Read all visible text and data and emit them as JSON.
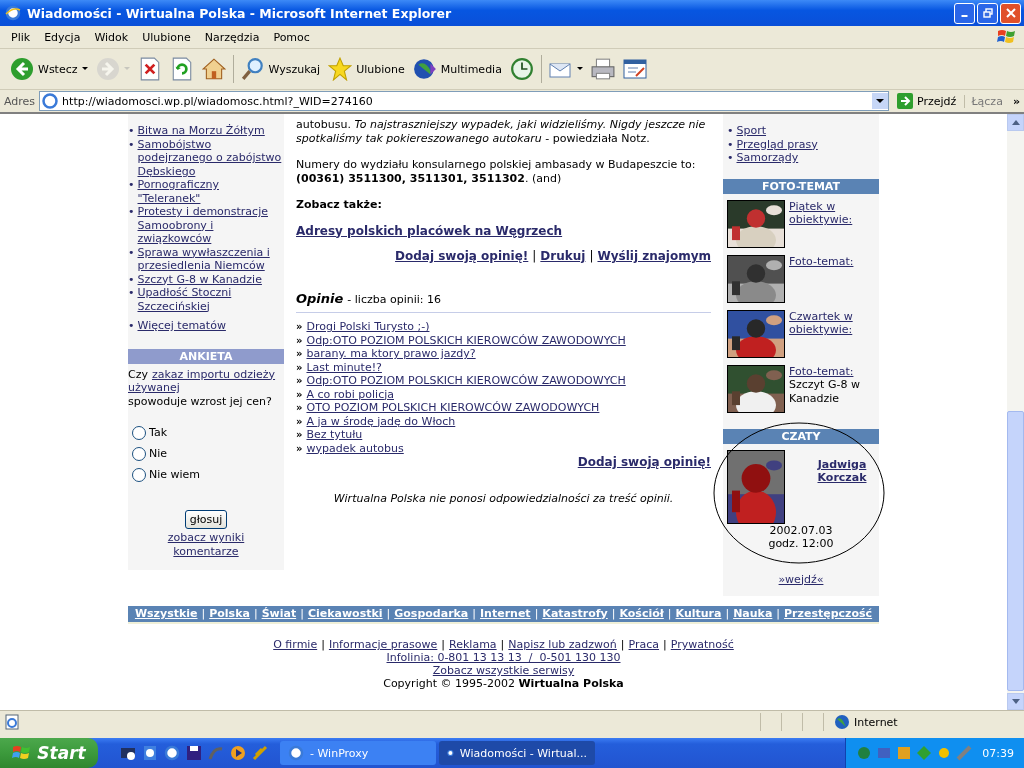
{
  "window": {
    "title": "Wiadomości - Wirtualna Polska - Microsoft Internet Explorer"
  },
  "menu": [
    "Plik",
    "Edycja",
    "Widok",
    "Ulubione",
    "Narzędzia",
    "Pomoc"
  ],
  "toolbar": {
    "groups": [
      [
        {
          "kind": "back",
          "label": "Wstecz",
          "dropdown": true,
          "disabled": false
        },
        {
          "kind": "forward",
          "dropdown": true,
          "disabled": true
        },
        {
          "kind": "stop",
          "dropdown": false,
          "disabled": false
        },
        {
          "kind": "refresh",
          "dropdown": false,
          "disabled": false
        },
        {
          "kind": "home",
          "dropdown": false,
          "disabled": false
        }
      ],
      [
        {
          "kind": "search",
          "label": "Wyszukaj",
          "dropdown": false,
          "disabled": false
        },
        {
          "kind": "favorites",
          "label": "Ulubione",
          "dropdown": false,
          "disabled": false
        },
        {
          "kind": "media",
          "label": "Multimedia",
          "dropdown": false,
          "disabled": false
        },
        {
          "kind": "history",
          "dropdown": false,
          "disabled": false
        }
      ],
      [
        {
          "kind": "mail",
          "dropdown": true,
          "disabled": false
        },
        {
          "kind": "print",
          "dropdown": false,
          "disabled": false
        },
        {
          "kind": "edit",
          "dropdown": false,
          "disabled": false
        }
      ]
    ]
  },
  "address": {
    "label": "Adres",
    "value": "http://wiadomosci.wp.pl/wiadomosc.html?_WID=274160",
    "go": "Przejdź",
    "links": "Łącza",
    "chevron": "»"
  },
  "left": {
    "bullet": "•",
    "topics": [
      "Bitwa na Morzu Żółtym",
      "Samobójstwo podejrzanego o zabójstwo Dębskiego",
      "Pornograficzny \"Teleranek\"",
      "Protesty i demonstracje Samoobrony i związkowców",
      "Sprawa wywłaszczenia i przesiedlenia Niemców",
      "Szczyt G-8 w Kanadzie",
      "Upadłość Stoczni Szczecińskiej"
    ],
    "more": "Więcej tematów",
    "poll": {
      "title": "ANKIETA",
      "question_pre": "Czy",
      "question_link": [
        "zakaz importu odzieży",
        "używanej"
      ],
      "question_post": "spowoduje wzrost jej cen?",
      "options": [
        {
          "label": "Tak",
          "selected": false
        },
        {
          "label": "Nie",
          "selected": false
        },
        {
          "label": "Nie wiem",
          "selected": false
        }
      ],
      "vote": "głosuj",
      "results": "zobacz wyniki komentarze"
    }
  },
  "article": {
    "paragraphs": [
      "autobusu. *To najstraszniejszy wypadek, jaki widzieliśmy. Nigdy jeszcze nie spotkaliśmy tak pokiereszowanego autokaru* - powiedziała Notz.",
      "Numery do wydziału konsularnego polskiej ambasady w Budapeszcie to: **(00361) 3511300, 3511301, 3511302**. (and)"
    ],
    "see_also_title": "Zobacz także:",
    "see_also_links": [
      "Adresy polskich placówek na Węgrzech"
    ],
    "actions": [
      "Dodaj swoją opinię!",
      "Drukuj",
      "Wyślij znajomym"
    ],
    "separator": "|"
  },
  "opinions": {
    "title": "Opinie",
    "count": "- liczba opinii: 16",
    "marker": "»",
    "items": [
      "Drogi Polski Turysto ;-)",
      "Odp:OTO POZIOM POLSKICH KIEROWCÓW ZAWODOWYCH",
      "barany. ma ktory prawo jazdy?",
      "Last minute!?",
      "Odp:OTO POZIOM POLSKICH KIEROWCÓW ZAWODOWYCH",
      "A co robi policja",
      "OTO POZIOM POLSKICH KIEROWCÓW ZAWODOWYCH",
      "A ja w środę jadę do Włoch",
      "Bez tytułu",
      "wypadek autobus"
    ],
    "add": "Dodaj swoją opinię!",
    "disclaimer": "Wirtualna Polska nie ponosi odpowiedzialności za treść opinii."
  },
  "right": {
    "bullet": "•",
    "sections": [
      "Sport",
      "Przegląd prasy",
      "Samorządy"
    ],
    "photo_title": "FOTO-TEMAT",
    "photos": [
      {
        "link": "Piątek w obiektywie:"
      },
      {
        "link": "Foto-temat:"
      },
      {
        "link": "Czwartek w obiektywie:"
      },
      {
        "link": "Foto-temat:",
        "caption": "Szczyt G-8 w Kanadzie"
      }
    ],
    "chat_title": "CZATY",
    "chat": {
      "name": "Jadwiga Korczak",
      "date": "2002.07.03",
      "time": "godz. 12:00"
    },
    "enter": "»wejdź«"
  },
  "footer": {
    "separator": "|",
    "categories": [
      "Wszystkie",
      "Polska",
      "Świat",
      "Ciekawostki",
      "Gospodarka",
      "Internet",
      "Katastrofy",
      "Kościół",
      "Kultura",
      "Nauka",
      "Przestępczość"
    ],
    "links": [
      "O firmie",
      "Informacje prasowe",
      "Reklama",
      "Napisz lub zadzwoń",
      "Praca",
      "Prywatność"
    ],
    "hotline": "Infolinia: 0-801 13 13 13  /  0-501 130 130",
    "all_services": "Zobacz wszystkie serwisy",
    "copyright": "Copyright © 1995-2002 **Wirtualna Polska**"
  },
  "status": {
    "zone": "Internet"
  },
  "taskbar": {
    "start": "Start",
    "tasks": [
      {
        "label": "- WinProxy",
        "selected": false
      },
      {
        "label": "Wiadomości - Wirtual...",
        "selected": true
      }
    ],
    "clock": "07:39"
  }
}
